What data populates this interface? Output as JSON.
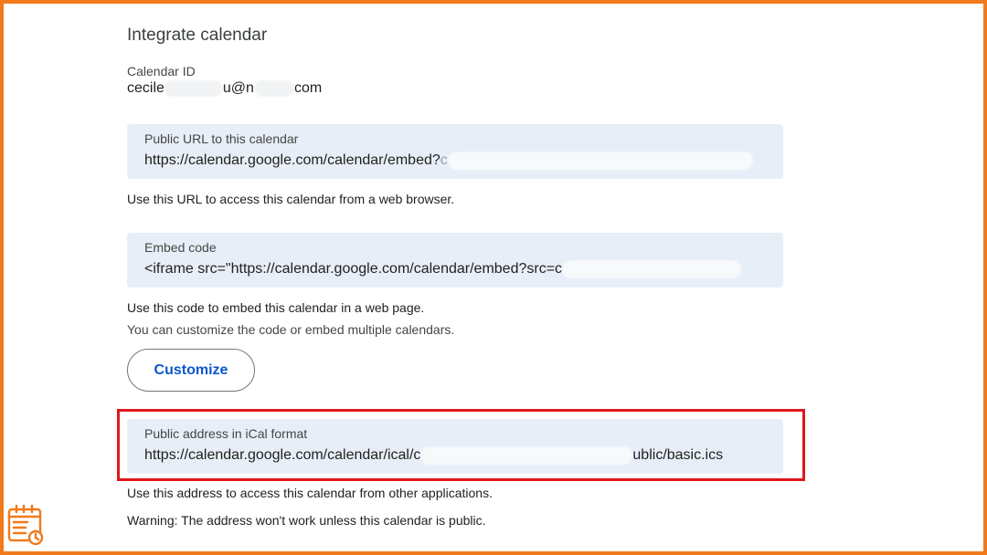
{
  "section": {
    "title": "Integrate calendar"
  },
  "calendar_id": {
    "label": "Calendar ID",
    "value_prefix": "cecile",
    "value_mid": "u@n",
    "value_suffix": "com"
  },
  "public_url": {
    "label": "Public URL to this calendar",
    "value_visible": "https://calendar.google.com/calendar/embed?",
    "value_tail": "c",
    "helper": "Use this URL to access this calendar from a web browser."
  },
  "embed_code": {
    "label": "Embed code",
    "value_visible": "<iframe src=\"https://calendar.google.com/calendar/embed?src=c",
    "helper": "Use this code to embed this calendar in a web page.",
    "helper_secondary": "You can customize the code or embed multiple calendars."
  },
  "customize_button": {
    "label": "Customize"
  },
  "ical": {
    "label": "Public address in iCal format",
    "value_prefix": "https://calendar.google.com/calendar/ical/c",
    "value_suffix": "ublic/basic.ics",
    "helper": "Use this address to access this calendar from other applications.",
    "warning": "Warning: The address won't work unless this calendar is public."
  },
  "colors": {
    "frame": "#f07a1c",
    "highlight": "#e0161b",
    "field_bg": "#e8eef7",
    "button_text": "#0b57d0"
  },
  "icons": {
    "corner_logo": "calendar-clock-icon"
  }
}
